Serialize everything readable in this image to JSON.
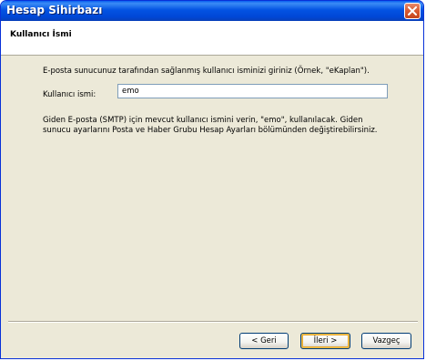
{
  "window": {
    "title": "Hesap Sihirbazı",
    "close_label": "close"
  },
  "header": {
    "title": "Kullanıcı İsmi"
  },
  "main": {
    "description": "E-posta sunucunuz tarafından sağlanmış kullanıcı isminizi giriniz (Örnek, \"eKaplan\").",
    "username_label": "Kullanıcı ismi:",
    "username_value": "emo",
    "info": "Giden E-posta (SMTP) için mevcut kullanıcı ismini verin, \"emo\", kullanılacak. Giden sunucu ayarlarını Posta ve Haber Grubu Hesap Ayarları bölümünden değiştirebilirsiniz."
  },
  "buttons": {
    "back_label": "< Geri",
    "next_label": "İleri >",
    "cancel_label": "Vazgeç"
  },
  "colors": {
    "titlebar": "#0353e3",
    "window_bg": "#ece9d8",
    "close_button": "#d85a30"
  }
}
